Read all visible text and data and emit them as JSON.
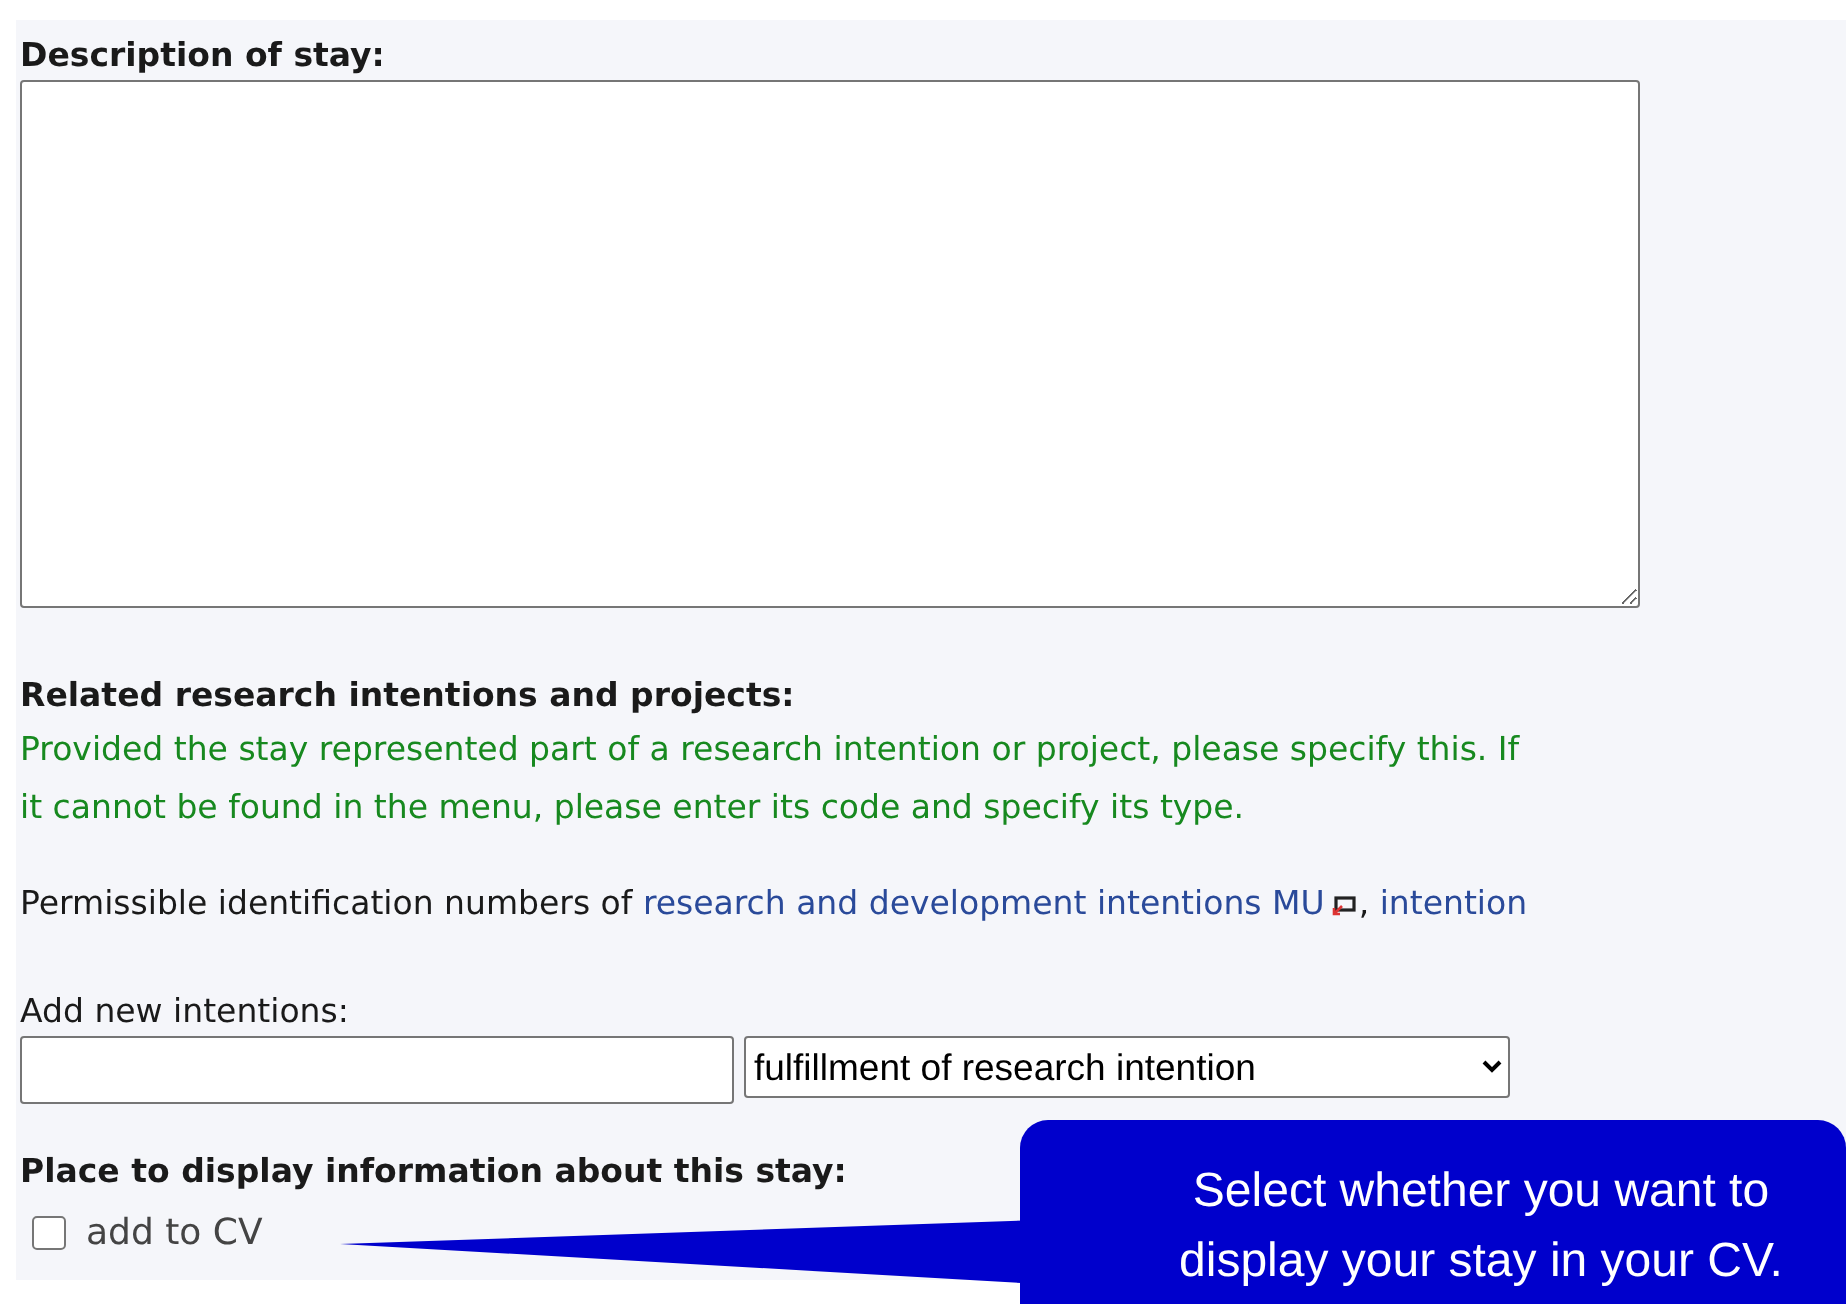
{
  "description": {
    "label": "Description of stay:"
  },
  "related": {
    "heading": "Related research intentions and projects:",
    "hint": "Provided the stay represented part of a research intention or project, please specify this. If it cannot be found in the menu, please enter its code and specify its type.",
    "permissible": {
      "text": "Permissible identification numbers of",
      "links": [
        "research and development intentions MU",
        "intention"
      ],
      "separator": ","
    }
  },
  "add_new": {
    "label": "Add new intentions:",
    "select_value": "fulfillment of research intention"
  },
  "display": {
    "heading": "Place to display information about this stay:",
    "options": [
      {
        "label": "add to CV",
        "checked": false
      }
    ]
  },
  "callout": {
    "text": "Select whether you want to display your stay in your CV."
  }
}
